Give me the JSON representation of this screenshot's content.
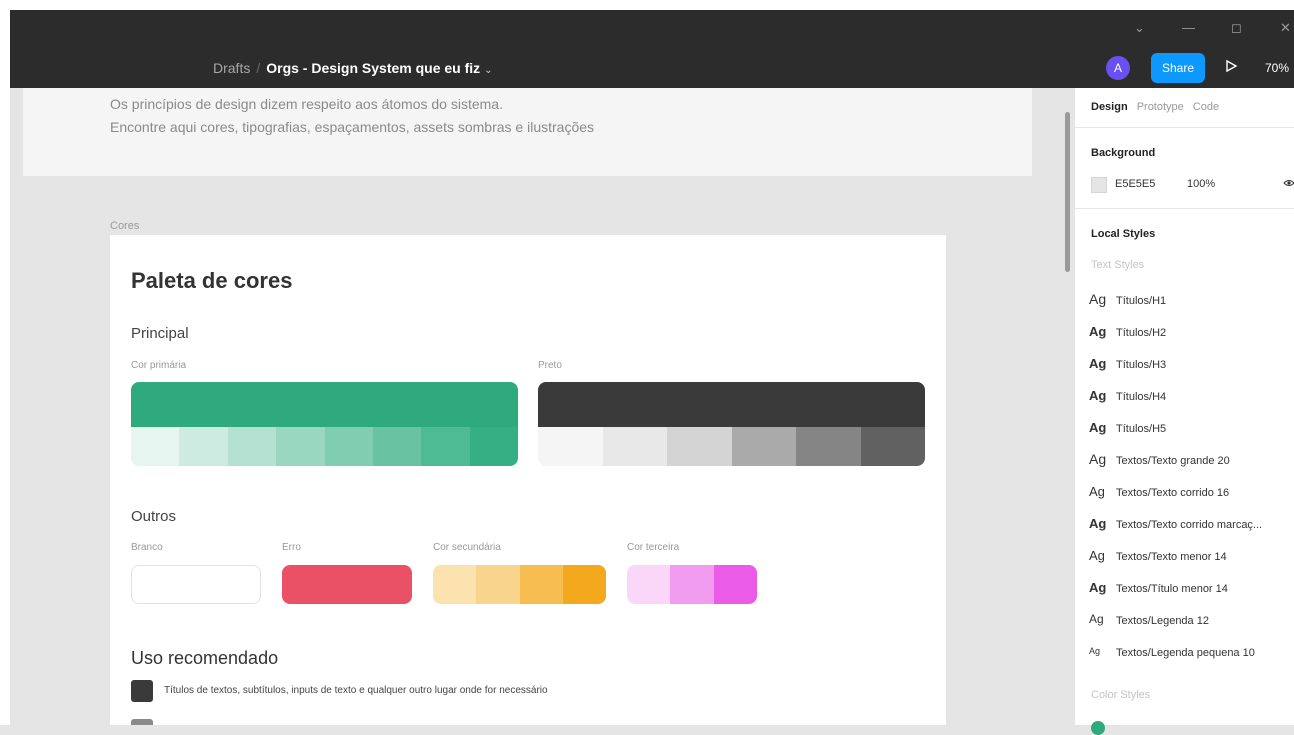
{
  "window": {
    "controls": [
      "⌄",
      "—",
      "◻",
      "✕"
    ]
  },
  "toolbar": {
    "breadcrumb_root": "Drafts",
    "breadcrumb_sep": "/",
    "file_name": "Orgs - Design System que eu fiz",
    "file_caret": "⌄",
    "avatar_initial": "A",
    "share_label": "Share",
    "play_glyph": "▷",
    "zoom": "70%"
  },
  "canvas": {
    "intro_line1": "Os princípios de design dizem respeito aos átomos do sistema.",
    "intro_line2": "Encontre aqui cores, tipografias, espaçamentos, assets sombras e ilustrações",
    "frame_label": "Cores",
    "frame": {
      "title": "Paleta de cores",
      "principal_heading": "Principal",
      "primary_label": "Cor primária",
      "primary_main": "#2eaa7e",
      "primary_shades": [
        "#e6f5ef",
        "#cdebe0",
        "#b4e1d1",
        "#9ad7c1",
        "#81cdb2",
        "#67c3a2",
        "#4ebb94",
        "#35b085"
      ],
      "black_label": "Preto",
      "black_main": "#3a3a3a",
      "black_shades": [
        "#f5f5f5",
        "#e8e8e8",
        "#d4d4d4",
        "#aaaaaa",
        "#858585",
        "#616161"
      ],
      "outros_heading": "Outros",
      "white_label": "Branco",
      "white_color": "#ffffff",
      "error_label": "Erro",
      "error_color": "#eb5166",
      "secondary_label": "Cor secundária",
      "secondary_shades": [
        "#fbe2ae",
        "#f9d48c",
        "#f6bd51",
        "#f3a81e"
      ],
      "tertiary_label": "Cor terceira",
      "tertiary_shades": [
        "#fad6f8",
        "#f29cef",
        "#ea5ce7"
      ],
      "uso_heading": "Uso recomendado",
      "uso_items": [
        {
          "color": "#3a3a3a",
          "text": "Títulos de textos, subtítulos, inputs de texto e qualquer outro lugar onde for necessário"
        },
        {
          "color": "#8a8a8a",
          "text": ""
        }
      ]
    }
  },
  "panel": {
    "tabs": [
      "Design",
      "Prototype",
      "Code"
    ],
    "active_tab": "Design",
    "background_heading": "Background",
    "bg_hex": "E5E5E5",
    "bg_opacity": "100%",
    "local_styles_heading": "Local Styles",
    "text_styles_heading": "Text Styles",
    "text_styles": [
      {
        "ag": "Ag",
        "label": "Títulos/H1",
        "weight": "normal",
        "size": 14
      },
      {
        "ag": "Ag",
        "label": "Títulos/H2",
        "weight": "bold",
        "size": 13
      },
      {
        "ag": "Ag",
        "label": "Títulos/H3",
        "weight": "bold",
        "size": 13
      },
      {
        "ag": "Ag",
        "label": "Títulos/H4",
        "weight": "bold",
        "size": 13
      },
      {
        "ag": "Ag",
        "label": "Títulos/H5",
        "weight": "bold",
        "size": 13
      },
      {
        "ag": "Ag",
        "label": "Textos/Texto grande 20",
        "weight": "normal",
        "size": 14
      },
      {
        "ag": "Ag",
        "label": "Textos/Texto corrido 16",
        "weight": "normal",
        "size": 13
      },
      {
        "ag": "Ag",
        "label": "Textos/Texto corrido marcaç...",
        "weight": "bold",
        "size": 13
      },
      {
        "ag": "Ag",
        "label": "Textos/Texto menor 14",
        "weight": "normal",
        "size": 13
      },
      {
        "ag": "Ag",
        "label": "Textos/Título menor 14",
        "weight": "bold",
        "size": 13
      },
      {
        "ag": "Ag",
        "label": "Textos/Legenda 12",
        "weight": "normal",
        "size": 12
      },
      {
        "ag": "Ag",
        "label": "Textos/Legenda pequena 10",
        "weight": "normal",
        "size": 9
      }
    ],
    "color_styles_heading": "Color Styles"
  }
}
